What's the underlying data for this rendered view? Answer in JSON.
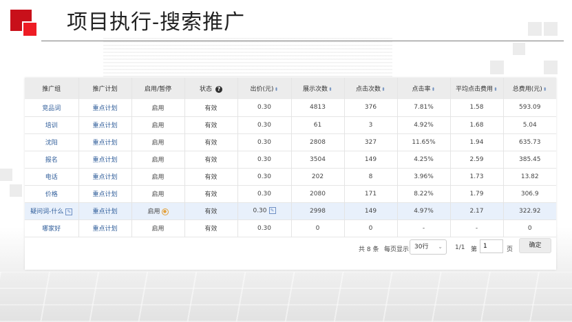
{
  "title": "项目执行-搜索推广",
  "table": {
    "headers": [
      {
        "label": "推广组",
        "sortable": false
      },
      {
        "label": "推广计划",
        "sortable": false
      },
      {
        "label": "启用/暂停",
        "sortable": false
      },
      {
        "label": "状态",
        "sortable": false,
        "help": true
      },
      {
        "label": "出价(元)",
        "sortable": true
      },
      {
        "label": "展示次数",
        "sortable": true
      },
      {
        "label": "点击次数",
        "sortable": true
      },
      {
        "label": "点击率",
        "sortable": true
      },
      {
        "label": "平均点击费用",
        "sortable": true
      },
      {
        "label": "总费用(元)",
        "sortable": true
      }
    ],
    "rows": [
      {
        "group": "竞品词",
        "plan": "重点计划",
        "enabled": "启用",
        "status": "有效",
        "bid": "0.30",
        "impressions": "4813",
        "clicks": "376",
        "ctr": "7.81%",
        "cpc": "1.58",
        "cost": "593.09",
        "highlight": false
      },
      {
        "group": "培训",
        "plan": "重点计划",
        "enabled": "启用",
        "status": "有效",
        "bid": "0.30",
        "impressions": "61",
        "clicks": "3",
        "ctr": "4.92%",
        "cpc": "1.68",
        "cost": "5.04",
        "highlight": false
      },
      {
        "group": "沈阳",
        "plan": "重点计划",
        "enabled": "启用",
        "status": "有效",
        "bid": "0.30",
        "impressions": "2808",
        "clicks": "327",
        "ctr": "11.65%",
        "cpc": "1.94",
        "cost": "635.73",
        "highlight": false
      },
      {
        "group": "报名",
        "plan": "重点计划",
        "enabled": "启用",
        "status": "有效",
        "bid": "0.30",
        "impressions": "3504",
        "clicks": "149",
        "ctr": "4.25%",
        "cpc": "2.59",
        "cost": "385.45",
        "highlight": false
      },
      {
        "group": "电话",
        "plan": "重点计划",
        "enabled": "启用",
        "status": "有效",
        "bid": "0.30",
        "impressions": "202",
        "clicks": "8",
        "ctr": "3.96%",
        "cpc": "1.73",
        "cost": "13.82",
        "highlight": false
      },
      {
        "group": "价格",
        "plan": "重点计划",
        "enabled": "启用",
        "status": "有效",
        "bid": "0.30",
        "impressions": "2080",
        "clicks": "171",
        "ctr": "8.22%",
        "cpc": "1.79",
        "cost": "306.9",
        "highlight": false
      },
      {
        "group": "疑问词-什么",
        "plan": "重点计划",
        "enabled": "启用",
        "status": "有效",
        "bid": "0.30",
        "impressions": "2998",
        "clicks": "149",
        "ctr": "4.97%",
        "cpc": "2.17",
        "cost": "322.92",
        "highlight": true
      },
      {
        "group": "哪家好",
        "plan": "重点计划",
        "enabled": "启用",
        "status": "有效",
        "bid": "0.30",
        "impressions": "0",
        "clicks": "0",
        "ctr": "-",
        "cpc": "-",
        "cost": "0",
        "highlight": false
      }
    ]
  },
  "pagination": {
    "total_label": "共 8 条",
    "per_page_label": "每页显示",
    "per_page_value": "30行",
    "page_status": "1/1",
    "goto_prefix": "第",
    "page_input_value": "1",
    "goto_suffix": "页",
    "confirm_label": "确定"
  },
  "colors": {
    "accent_red": "#ee1c24",
    "link_blue": "#2f5d9a",
    "header_bg": "#ececec",
    "highlight_row_bg": "#e8f0fb"
  }
}
